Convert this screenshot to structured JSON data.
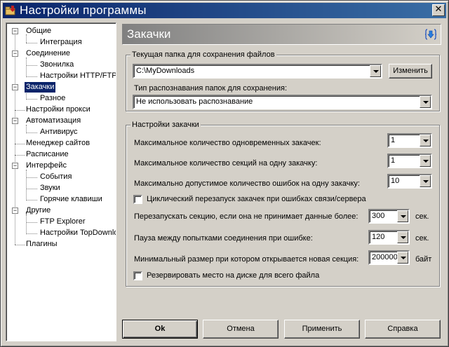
{
  "window": {
    "title": "Настройки программы",
    "close_glyph": "✕",
    "icon": "app-icon"
  },
  "tree": {
    "items": [
      {
        "label": "Общие"
      },
      {
        "label": "Интеграция"
      },
      {
        "label": "Соединение"
      },
      {
        "label": "Звонилка"
      },
      {
        "label": "Настройки HTTP/FTP"
      },
      {
        "label": "Закачки",
        "selected": true
      },
      {
        "label": "Разное"
      },
      {
        "label": "Настройки прокси"
      },
      {
        "label": "Автоматизация"
      },
      {
        "label": "Антивирус"
      },
      {
        "label": "Менеджер сайтов"
      },
      {
        "label": "Расписание"
      },
      {
        "label": "Интерфейс"
      },
      {
        "label": "События"
      },
      {
        "label": "Звуки"
      },
      {
        "label": "Горячие клавиши"
      },
      {
        "label": "Другие"
      },
      {
        "label": "FTP Explorer"
      },
      {
        "label": "Настройки TopDownloads"
      },
      {
        "label": "Плагины"
      }
    ]
  },
  "header": {
    "title": "Закачки",
    "icon": "download-arrow-icon"
  },
  "folder_group": {
    "legend": "Текущая папка для сохранения файлов",
    "path_value": "C:\\MyDownloads",
    "change_button": "Изменить",
    "recognition_label": "Тип распознавания папок для сохранения:",
    "recognition_value": "Не использовать распознавание"
  },
  "download_group": {
    "legend": "Настройки закачки",
    "max_downloads_label": "Максимальное количество одновременных закачек:",
    "max_downloads_value": "1",
    "max_sections_label": "Максимальное количество секций на одну закачку:",
    "max_sections_value": "1",
    "max_errors_label": "Максимально допустимое количество ошибок на одну закачку:",
    "max_errors_value": "10",
    "cyclic_restart_label": "Циклический перезапуск закачек при ошибках связи/сервера",
    "cyclic_restart_checked": false,
    "restart_section_label": "Перезапускать секцию, если она не принимает данные более:",
    "restart_section_value": "300",
    "restart_section_unit": "сек.",
    "pause_label": "Пауза между попытками соединения при ошибке:",
    "pause_value": "120",
    "pause_unit": "сек.",
    "min_size_label": "Минимальный размер при котором открывается новая секция:",
    "min_size_value": "200000",
    "min_size_unit": "байт",
    "reserve_label": "Резервировать место на диске для всего файла",
    "reserve_checked": false
  },
  "footer": {
    "ok": "Ok",
    "cancel": "Отмена",
    "apply": "Применить",
    "help": "Справка"
  },
  "colors": {
    "titlebar": "#0a246a",
    "selection": "#0a246a",
    "face": "#d4d0c8"
  }
}
